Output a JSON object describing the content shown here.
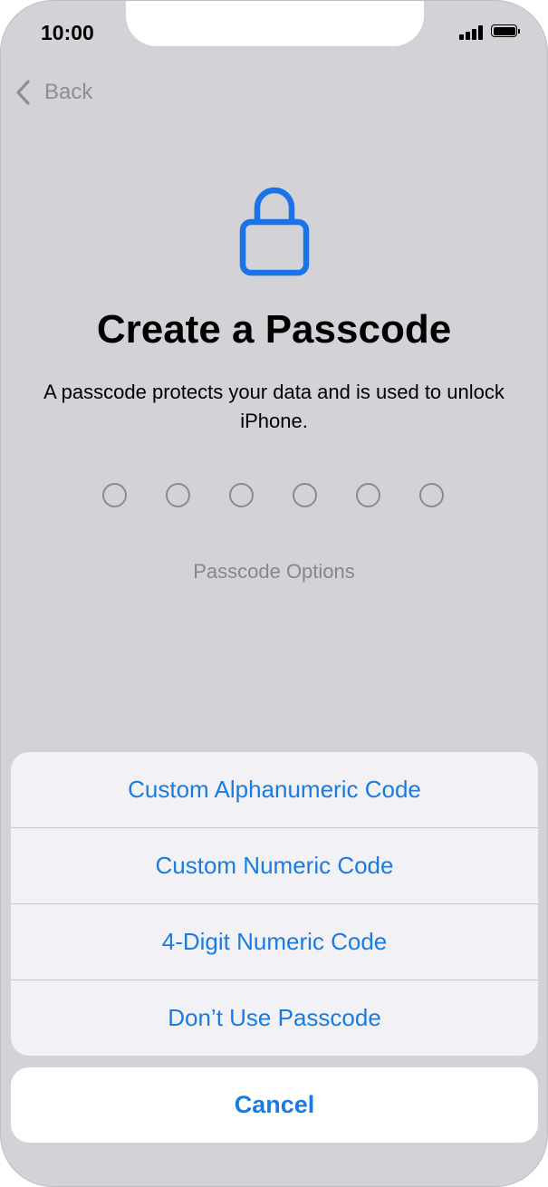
{
  "status_bar": {
    "time": "10:00",
    "signal_icon": "cellular-signal-icon",
    "battery_icon": "battery-icon"
  },
  "nav": {
    "back_label": "Back",
    "back_icon": "chevron-left-icon"
  },
  "hero": {
    "icon": "lock-icon",
    "icon_color": "#1a73e8",
    "title": "Create a Passcode",
    "subtitle": "A passcode protects your data and is used to unlock iPhone.",
    "passcode_length": 6,
    "entered_digits": 0,
    "options_label": "Passcode Options"
  },
  "action_sheet": {
    "items": [
      {
        "label": "Custom Alphanumeric Code"
      },
      {
        "label": "Custom Numeric Code"
      },
      {
        "label": "4-Digit Numeric Code"
      },
      {
        "label": "Don’t Use Passcode"
      }
    ],
    "cancel_label": "Cancel",
    "accent_color": "#1a7ce0"
  }
}
